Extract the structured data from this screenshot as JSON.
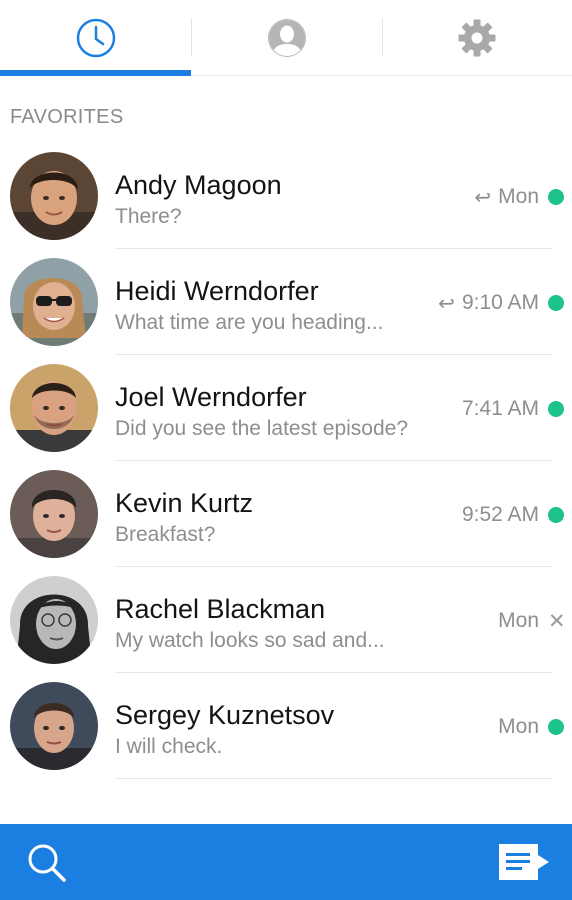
{
  "tabs": [
    {
      "icon": "clock-icon",
      "active": true
    },
    {
      "icon": "person-icon",
      "active": false
    },
    {
      "icon": "gear-icon",
      "active": false
    }
  ],
  "colors": {
    "accent": "#1a7fe0",
    "online": "#1ec28b"
  },
  "section_title": "FAVORITES",
  "contacts": [
    {
      "name": "Andy Magoon",
      "preview": "There?",
      "time": "Mon",
      "replied": true,
      "status": "online"
    },
    {
      "name": "Heidi Werndorfer",
      "preview": "What time are you heading...",
      "time": "9:10 AM",
      "replied": true,
      "status": "online"
    },
    {
      "name": "Joel Werndorfer",
      "preview": "Did you see the latest episode?",
      "time": "7:41 AM",
      "replied": false,
      "status": "online"
    },
    {
      "name": "Kevin Kurtz",
      "preview": "Breakfast?",
      "time": "9:52 AM",
      "replied": false,
      "status": "online"
    },
    {
      "name": "Rachel Blackman",
      "preview": "My watch looks so sad and...",
      "time": "Mon",
      "replied": false,
      "status": "x"
    },
    {
      "name": "Sergey Kuznetsov",
      "preview": "I will check.",
      "time": "Mon",
      "replied": false,
      "status": "online"
    }
  ],
  "bottom_bar": {
    "left_icon": "search-icon",
    "right_icon": "compose-message-icon"
  }
}
